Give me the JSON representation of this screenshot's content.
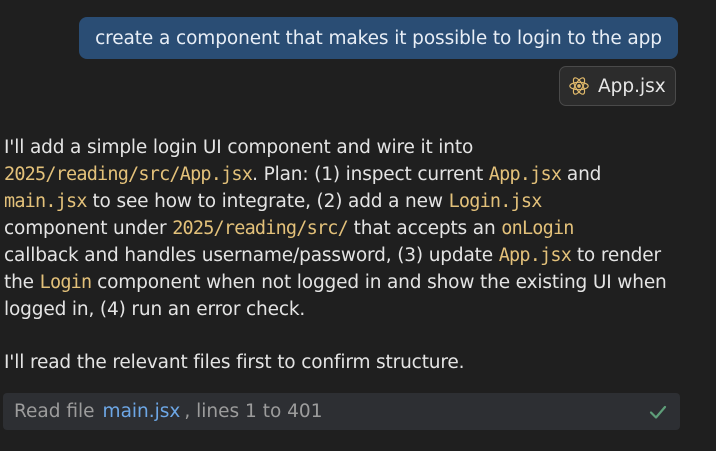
{
  "user_message": {
    "text": "create a component that makes it possible to login to the app"
  },
  "attachment": {
    "icon": "react-icon",
    "label": "App.jsx"
  },
  "assistant": {
    "lines": [
      [
        {
          "t": "I'll add a simple login UI component and wire it into"
        }
      ],
      [
        {
          "t": "2025/reading/src/App.jsx",
          "code": true
        },
        {
          "t": ". Plan: (1) inspect current "
        },
        {
          "t": "App.jsx",
          "code": true
        },
        {
          "t": " and"
        }
      ],
      [
        {
          "t": "main.jsx",
          "code": true
        },
        {
          "t": " to see how to integrate, (2) add a new "
        },
        {
          "t": "Login.jsx",
          "code": true
        }
      ],
      [
        {
          "t": "component under "
        },
        {
          "t": "2025/reading/src/",
          "code": true
        },
        {
          "t": " that accepts an "
        },
        {
          "t": "onLogin",
          "code": true
        }
      ],
      [
        {
          "t": "callback and handles username/password, (3) update "
        },
        {
          "t": "App.jsx",
          "code": true
        },
        {
          "t": " to render"
        }
      ],
      [
        {
          "t": "the "
        },
        {
          "t": "Login",
          "code": true
        },
        {
          "t": " component when not logged in and show the existing UI when"
        }
      ],
      [
        {
          "t": "logged in, (4) run an error check."
        }
      ]
    ],
    "followup": "I'll read the relevant files first to confirm structure."
  },
  "tool_call": {
    "action": "Read file",
    "file": "main.jsx",
    "range": ", lines 1 to 401",
    "status_icon": "check-icon",
    "status_color": "#5e9e79"
  }
}
